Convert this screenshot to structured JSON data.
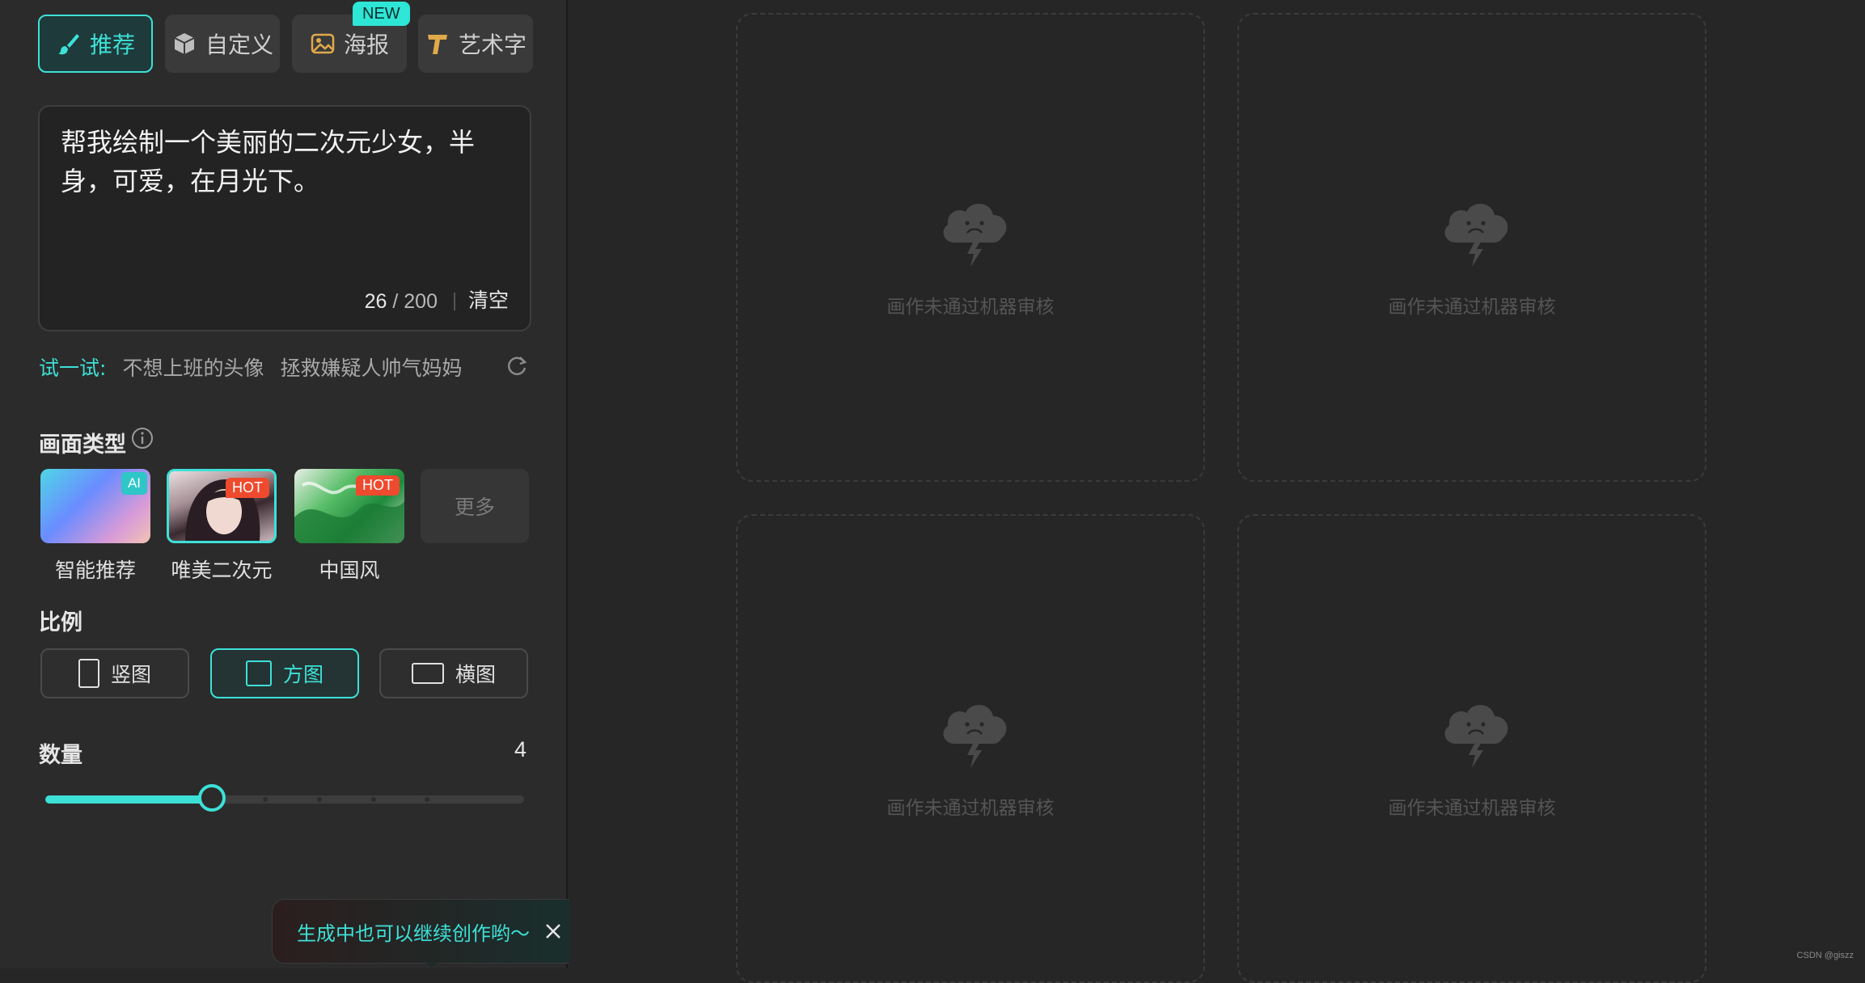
{
  "tabs": [
    {
      "label": "推荐",
      "icon": "brush-icon",
      "active": true
    },
    {
      "label": "自定义",
      "icon": "cube-icon",
      "active": false
    },
    {
      "label": "海报",
      "icon": "image-icon",
      "active": false
    },
    {
      "label": "艺术字",
      "icon": "text-t-icon",
      "active": false
    }
  ],
  "new_badge": "NEW",
  "prompt": {
    "text": "帮我绘制一个美丽的二次元少女，半身，可爱，在月光下。",
    "count": "26",
    "max": "/ 200",
    "clear_label": "清空"
  },
  "try_it": {
    "label": "试一试:",
    "items": [
      "不想上班的头像",
      "拯救嫌疑人帅气妈妈"
    ]
  },
  "style_section": {
    "title": "画面类型",
    "cards": [
      {
        "label": "智能推荐",
        "tag": "AI",
        "selected": false
      },
      {
        "label": "唯美二次元",
        "tag": "HOT",
        "selected": true
      },
      {
        "label": "中国风",
        "tag": "HOT",
        "selected": false
      }
    ],
    "more_label": "更多"
  },
  "ratio_section": {
    "title": "比例",
    "options": [
      {
        "label": "竖图",
        "active": false
      },
      {
        "label": "方图",
        "active": true
      },
      {
        "label": "横图",
        "active": false
      }
    ]
  },
  "quantity": {
    "title": "数量",
    "value": "4",
    "min": 1,
    "max": 9,
    "current": 4
  },
  "toast": {
    "text": "生成中也可以继续创作哟～"
  },
  "results": [
    {
      "status": "画作未通过机器审核"
    },
    {
      "status": "画作未通过机器审核"
    },
    {
      "status": "画作未通过机器审核"
    },
    {
      "status": "画作未通过机器审核"
    }
  ],
  "watermark": "CSDN @giszz",
  "colors": {
    "accent": "#3de0d6",
    "hot": "#ef4a2e",
    "background": "#262626",
    "sidebar": "#2b2b2b"
  }
}
